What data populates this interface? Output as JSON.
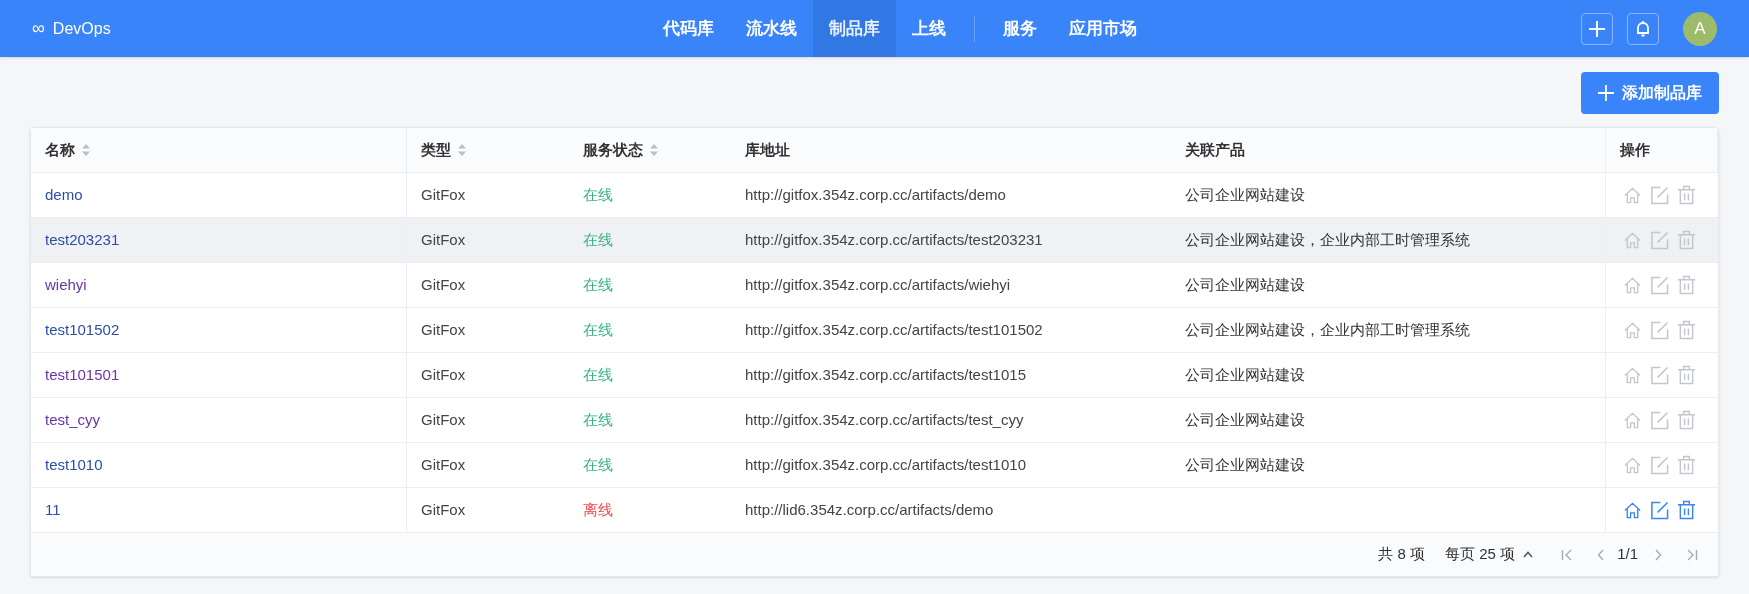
{
  "app": {
    "logo_symbol": "∞",
    "name": "DevOps"
  },
  "nav": [
    {
      "label": "代码库",
      "selected": false,
      "kind": "link"
    },
    {
      "label": "流水线",
      "selected": false,
      "kind": "link"
    },
    {
      "label": "制品库",
      "selected": true,
      "kind": "link"
    },
    {
      "label": "上线",
      "selected": false,
      "kind": "link"
    },
    {
      "kind": "divider"
    },
    {
      "label": "服务",
      "selected": false,
      "kind": "link"
    },
    {
      "label": "应用市场",
      "selected": false,
      "kind": "link"
    }
  ],
  "user": {
    "avatar": "A"
  },
  "add_button": {
    "label": "添加制品库"
  },
  "table": {
    "columns": [
      {
        "label": "名称",
        "sortable": true
      },
      {
        "label": "类型",
        "sortable": true
      },
      {
        "label": "服务状态",
        "sortable": true
      },
      {
        "label": "库地址",
        "sortable": false
      },
      {
        "label": "关联产品",
        "sortable": false
      },
      {
        "label": "操作",
        "sortable": false
      }
    ],
    "rows": [
      {
        "name": "demo",
        "visited": false,
        "type": "GitFox",
        "status": {
          "text": "在线",
          "kind": "online"
        },
        "address": "http://gitfox.354z.corp.cc/artifacts/demo",
        "products": "公司企业网站建设",
        "highlighted": false,
        "actions_active": false
      },
      {
        "name": "test203231",
        "visited": false,
        "type": "GitFox",
        "status": {
          "text": "在线",
          "kind": "online"
        },
        "address": "http://gitfox.354z.corp.cc/artifacts/test203231",
        "products": "公司企业网站建设，企业内部工时管理系统",
        "highlighted": true,
        "actions_active": false
      },
      {
        "name": "wiehyi",
        "visited": true,
        "type": "GitFox",
        "status": {
          "text": "在线",
          "kind": "online"
        },
        "address": "http://gitfox.354z.corp.cc/artifacts/wiehyi",
        "products": "公司企业网站建设",
        "highlighted": false,
        "actions_active": false
      },
      {
        "name": "test101502",
        "visited": false,
        "type": "GitFox",
        "status": {
          "text": "在线",
          "kind": "online"
        },
        "address": "http://gitfox.354z.corp.cc/artifacts/test101502",
        "products": "公司企业网站建设，企业内部工时管理系统",
        "highlighted": false,
        "actions_active": false
      },
      {
        "name": "test101501",
        "visited": true,
        "type": "GitFox",
        "status": {
          "text": "在线",
          "kind": "online"
        },
        "address": "http://gitfox.354z.corp.cc/artifacts/test1015",
        "products": "公司企业网站建设",
        "highlighted": false,
        "actions_active": false
      },
      {
        "name": "test_cyy",
        "visited": true,
        "type": "GitFox",
        "status": {
          "text": "在线",
          "kind": "online"
        },
        "address": "http://gitfox.354z.corp.cc/artifacts/test_cyy",
        "products": "公司企业网站建设",
        "highlighted": false,
        "actions_active": false
      },
      {
        "name": "test1010",
        "visited": false,
        "type": "GitFox",
        "status": {
          "text": "在线",
          "kind": "online"
        },
        "address": "http://gitfox.354z.corp.cc/artifacts/test1010",
        "products": "公司企业网站建设",
        "highlighted": false,
        "actions_active": false
      },
      {
        "name": "11",
        "visited": false,
        "type": "GitFox",
        "status": {
          "text": "离线",
          "kind": "offline"
        },
        "address": "http://lid6.354z.corp.cc/artifacts/demo",
        "highlighted": false,
        "actions_active": true
      }
    ]
  },
  "pagination": {
    "total": "共 8 项",
    "page_size": "每页 25 项",
    "page": "1/1"
  }
}
